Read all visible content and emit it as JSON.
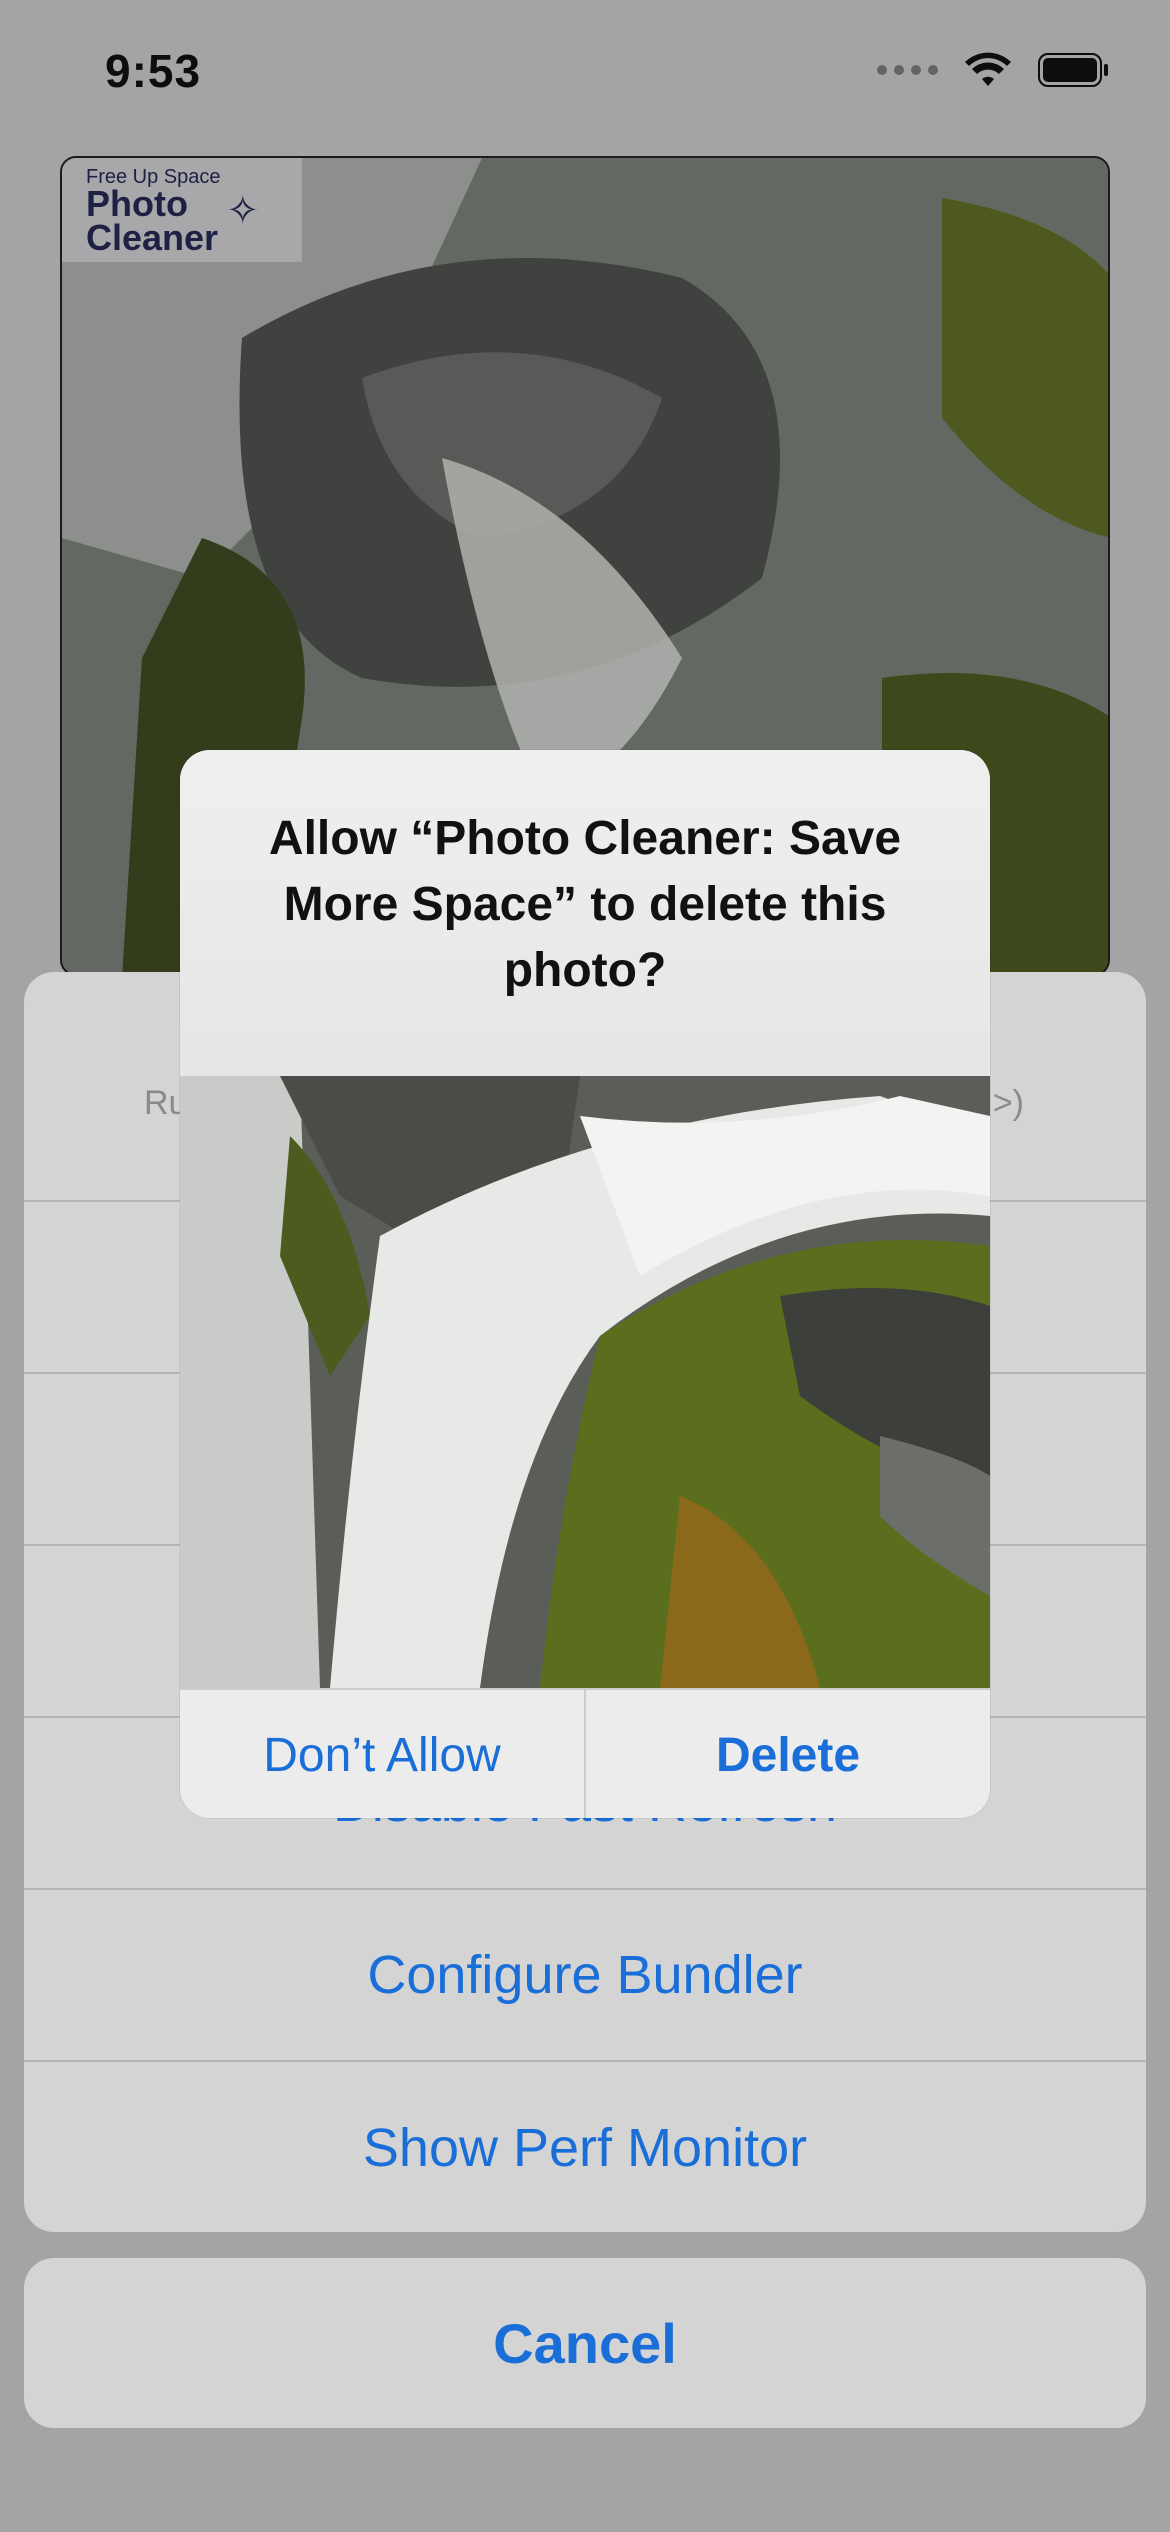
{
  "status_bar": {
    "time": "9:53"
  },
  "logo": {
    "line1": "Free Up Space",
    "line2": "Photo",
    "line3": "Cleaner"
  },
  "action_sheet": {
    "message_left": "Ru",
    "message_right": ">)",
    "items": [
      {
        "label": ""
      },
      {
        "label": ""
      },
      {
        "label": ""
      },
      {
        "label": "Disable Fast Refresh"
      },
      {
        "label": "Configure Bundler"
      },
      {
        "label": "Show Perf Monitor"
      }
    ],
    "cancel_label": "Cancel"
  },
  "alert": {
    "title": "Allow “Photo Cleaner: Save More Space” to delete this photo?",
    "deny_label": "Don’t Allow",
    "confirm_label": "Delete"
  },
  "colors": {
    "accent": "#1a6ed8",
    "sheet_bg": "#d4d4d4"
  }
}
